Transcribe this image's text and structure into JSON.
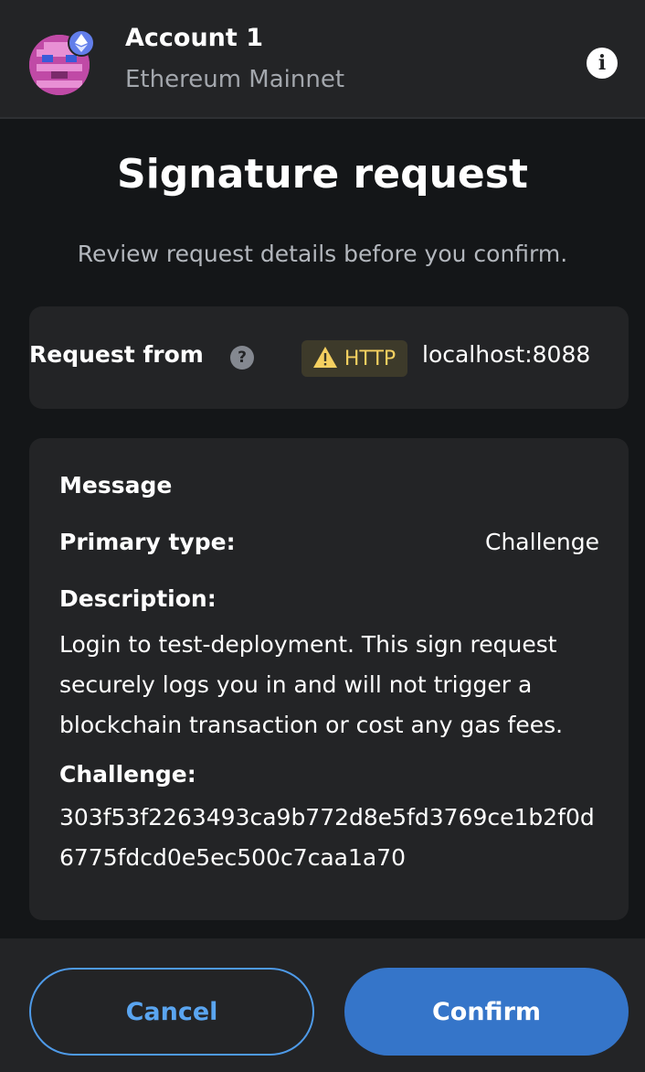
{
  "header": {
    "account_name": "Account 1",
    "network_name": "Ethereum Mainnet"
  },
  "main": {
    "title": "Signature request",
    "subtitle": "Review request details before you confirm."
  },
  "request": {
    "label": "Request from",
    "badge_text": "HTTP",
    "host": "localhost:8088"
  },
  "message": {
    "heading": "Message",
    "primary_type_label": "Primary type:",
    "primary_type_value": "Challenge",
    "description_label": "Description:",
    "description_value": "Login to test-deployment. This sign request securely logs you in and will not trigger a blockchain transaction or cost any gas fees.",
    "challenge_label": "Challenge:",
    "challenge_value": "303f53f2263493ca9b772d8e5fd3769ce1b2f0d6775fdcd0e5ec500c7caa1a70"
  },
  "footer": {
    "cancel_label": "Cancel",
    "confirm_label": "Confirm"
  },
  "colors": {
    "background": "#141618",
    "card": "#232426",
    "accent": "#3575c9",
    "warning": "#f5d060"
  },
  "icons": [
    "account-avatar",
    "ethereum-icon",
    "info-icon",
    "question-icon",
    "warning-icon"
  ]
}
